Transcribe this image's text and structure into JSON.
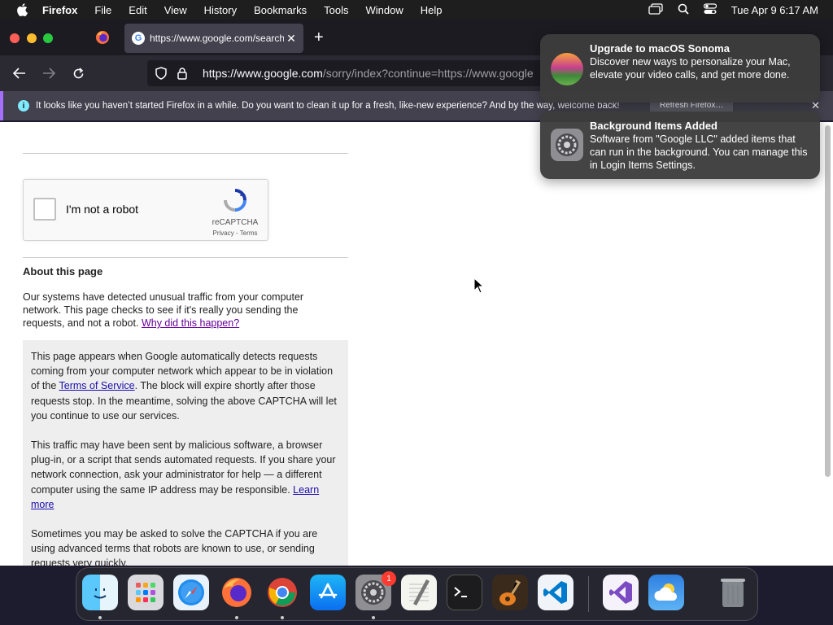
{
  "menubar": {
    "app_name": "Firefox",
    "items": [
      "File",
      "Edit",
      "View",
      "History",
      "Bookmarks",
      "Tools",
      "Window",
      "Help"
    ],
    "clock": "Tue Apr 9  6:17 AM"
  },
  "browser": {
    "tab_title": "https://www.google.com/search",
    "url_host": "https://www.google.com",
    "url_path": "/sorry/index?continue=https://www.google",
    "notification_message": "It looks like you haven’t started Firefox in a while. Do you want to clean it up for a fresh, like-new experience? And by the way, welcome back!",
    "refresh_label": "Refresh Firefox…"
  },
  "page": {
    "captcha_label": "I'm not a robot",
    "captcha_brand": "reCAPTCHA",
    "captcha_links": "Privacy - Terms",
    "about_heading": "About this page",
    "about_text": "Our systems have detected unusual traffic from your computer network. This page checks to see if it's really you sending the requests, and not a robot.",
    "about_link": "Why did this happen?",
    "para1_before": "This page appears when Google automatically detects requests coming from your computer network which appear to be in violation of the ",
    "para1_link": "Terms of Service",
    "para1_after": ". The block will expire shortly after those requests stop. In the meantime, solving the above CAPTCHA will let you continue to use our services.",
    "para2_before": "This traffic may have been sent by malicious software, a browser plug-in, or a script that sends automated requests. If you share your network connection, ask your administrator for help — a different computer using the same IP address may be responsible. ",
    "para2_link": "Learn more",
    "para3": "Sometimes you may be asked to solve the CAPTCHA if you are using advanced terms that robots are known to use, or sending requests very quickly."
  },
  "notifications": [
    {
      "title": "Upgrade to macOS Sonoma",
      "body": "Discover new ways to personalize your Mac, elevate your video calls, and get more done."
    },
    {
      "title": "Background Items Added",
      "body": "Software from \"Google LLC\" added items that can run in the background. You can manage this in Login Items Settings."
    }
  ],
  "dock": {
    "apps": [
      "Finder",
      "Launchpad",
      "Safari",
      "Firefox",
      "Google Chrome",
      "App Store",
      "System Settings",
      "TextEdit",
      "Terminal",
      "GarageBand",
      "Visual Studio Code",
      "Visual Studio",
      "Weather",
      "Trash"
    ],
    "settings_badge": "1"
  }
}
